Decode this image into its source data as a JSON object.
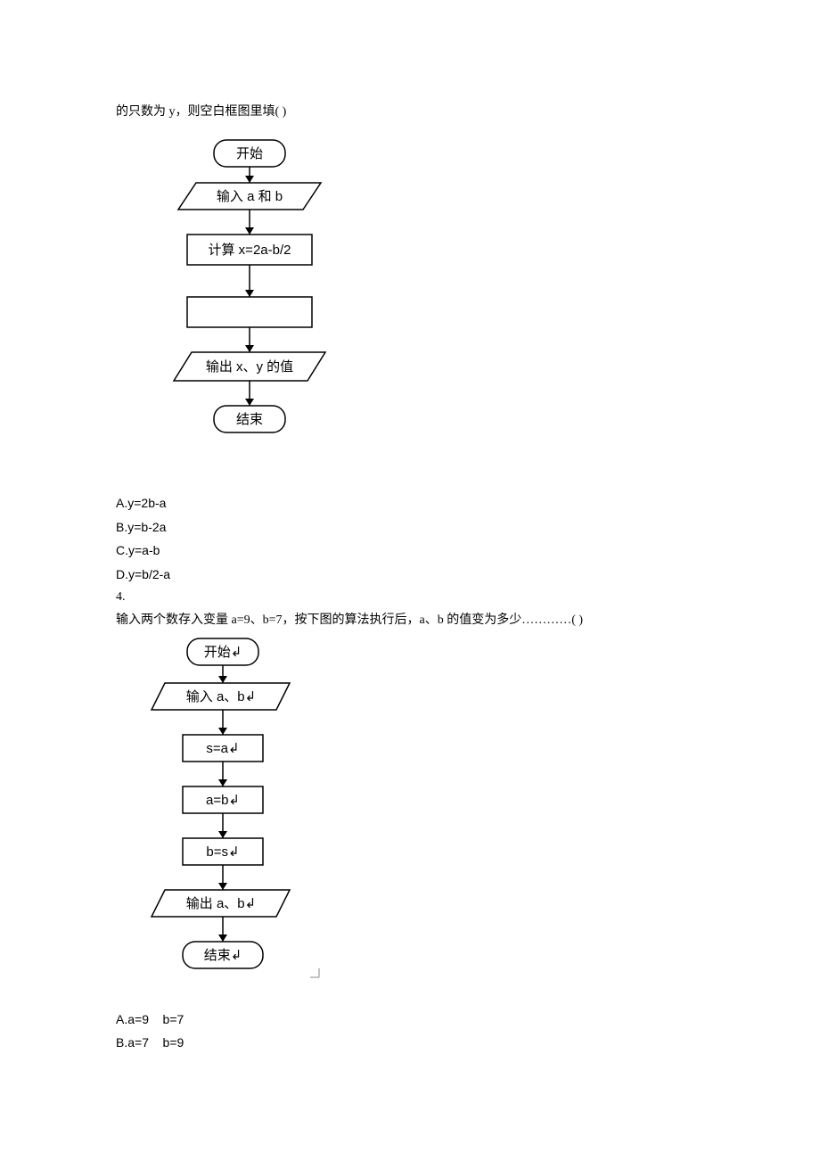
{
  "q3": {
    "prompt_tail": "的只数为 y，则空白框图里填(      )",
    "flow": {
      "start": "开始",
      "input": "输入 a 和 b",
      "calc": "计算 x=2a-b/2",
      "blank": "",
      "output": "输出 x、y 的值",
      "end": "结束"
    },
    "options": {
      "a": "A.y=2b-a",
      "b": "B.y=b-2a",
      "c": "C.y=a-b",
      "d": "D.y=b/2-a"
    }
  },
  "q4": {
    "number": "4.",
    "prompt": "输入两个数存入变量 a=9、b=7，按下图的算法执行后，a、b 的值变为多少…………(       )",
    "flow": {
      "start": "开始↲",
      "input": "输入 a、b↲",
      "s_eq_a": "s=a↲",
      "a_eq_b": "a=b↲",
      "b_eq_s": "b=s↲",
      "output": "输出 a、b↲",
      "end": "结束↲"
    },
    "options": {
      "a": "A.a=9    b=7",
      "b": "B.a=7    b=9"
    }
  }
}
